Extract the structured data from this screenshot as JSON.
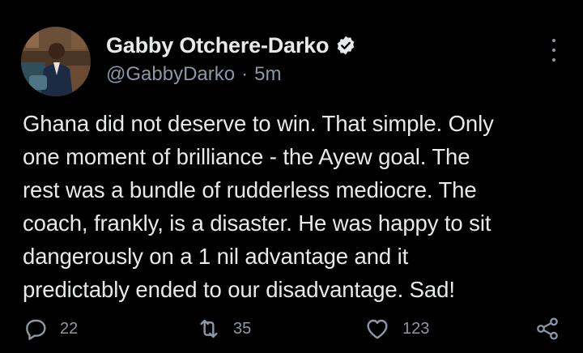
{
  "tweet": {
    "author": {
      "display_name": "Gabby Otchere-Darko",
      "handle": "@GabbyDarko",
      "separator": "·",
      "time": "5m",
      "verified_icon": "verified-badge-icon"
    },
    "text_lines": [
      "Ghana did not deserve to win. That simple. Only",
      "one moment of brilliance - the Ayew goal. The",
      "rest was a bundle of rudderless mediocre. The",
      "coach, frankly, is a disaster. He was happy to sit",
      "dangerously on a 1 nil advantage and it",
      "predictably ended to our disadvantage. Sad!"
    ],
    "actions": {
      "reply": {
        "icon": "reply-icon",
        "count": "22"
      },
      "retweet": {
        "icon": "retweet-icon",
        "count": "35"
      },
      "like": {
        "icon": "heart-icon",
        "count": "123"
      },
      "share": {
        "icon": "share-icon"
      }
    },
    "more_icon": "more-vertical-icon"
  },
  "colors": {
    "background": "#000000",
    "primary_text": "#e7e9ea",
    "secondary_text": "#8b98a5"
  }
}
